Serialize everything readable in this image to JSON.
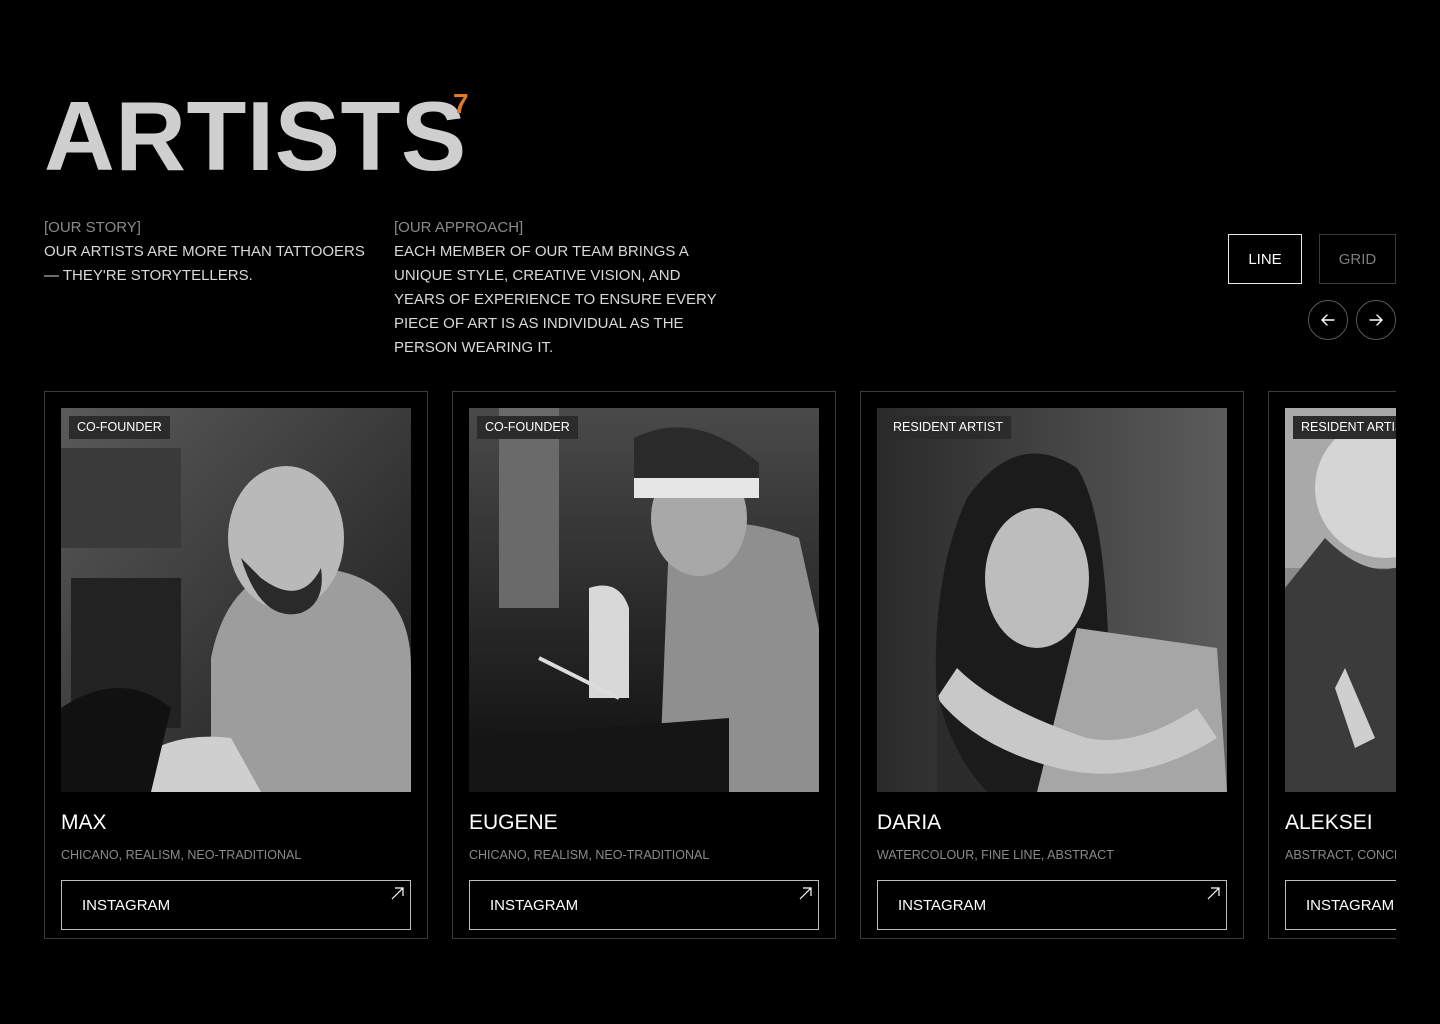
{
  "header": {
    "title": "ARTISTS",
    "count": "7"
  },
  "story": {
    "label": "[OUR STORY]",
    "text": "OUR ARTISTS ARE MORE THAN TATTOOERS — THEY'RE STORYTELLERS."
  },
  "approach": {
    "label": "[OUR APPROACH]",
    "text": "EACH MEMBER OF OUR TEAM BRINGS A UNIQUE STYLE, CREATIVE VISION, AND YEARS OF EXPERIENCE TO ENSURE EVERY PIECE OF ART IS AS INDIVIDUAL AS THE PERSON WEARING IT."
  },
  "view_toggle": {
    "line_label": "LINE",
    "grid_label": "GRID",
    "selected": "LINE"
  },
  "nav": {
    "prev_icon": "arrow-left-icon",
    "next_icon": "arrow-right-icon"
  },
  "artists": [
    {
      "role": "CO-FOUNDER",
      "name": "MAX",
      "styles": "CHICANO, REALISM, NEO-TRADITIONAL",
      "link_label": "INSTAGRAM",
      "photo": "bald bearded man in hoodie tattooing, black-and-white"
    },
    {
      "role": "CO-FOUNDER",
      "name": "EUGENE",
      "styles": "CHICANO, REALISM, NEO-TRADITIONAL",
      "link_label": "INSTAGRAM",
      "photo": "man in beanie and glasses drawing on tablet, black-and-white"
    },
    {
      "role": "RESIDENT ARTIST",
      "name": "DARIA",
      "styles": "WATERCOLOUR, FINE LINE, ABSTRACT",
      "link_label": "INSTAGRAM",
      "photo": "woman with long hair and tattooed arm portrait, black-and-white"
    },
    {
      "role": "RESIDENT ARTIST",
      "name": "ALEKSEI",
      "styles": "ABSTRACT, CONCEPTUAL",
      "link_label": "INSTAGRAM",
      "photo": "curly-haired man tattooing, black-and-white"
    }
  ],
  "colors": {
    "background": "#000000",
    "accent": "#e07a1f",
    "title": "#cfcfcf",
    "muted": "#8a8a8a"
  }
}
